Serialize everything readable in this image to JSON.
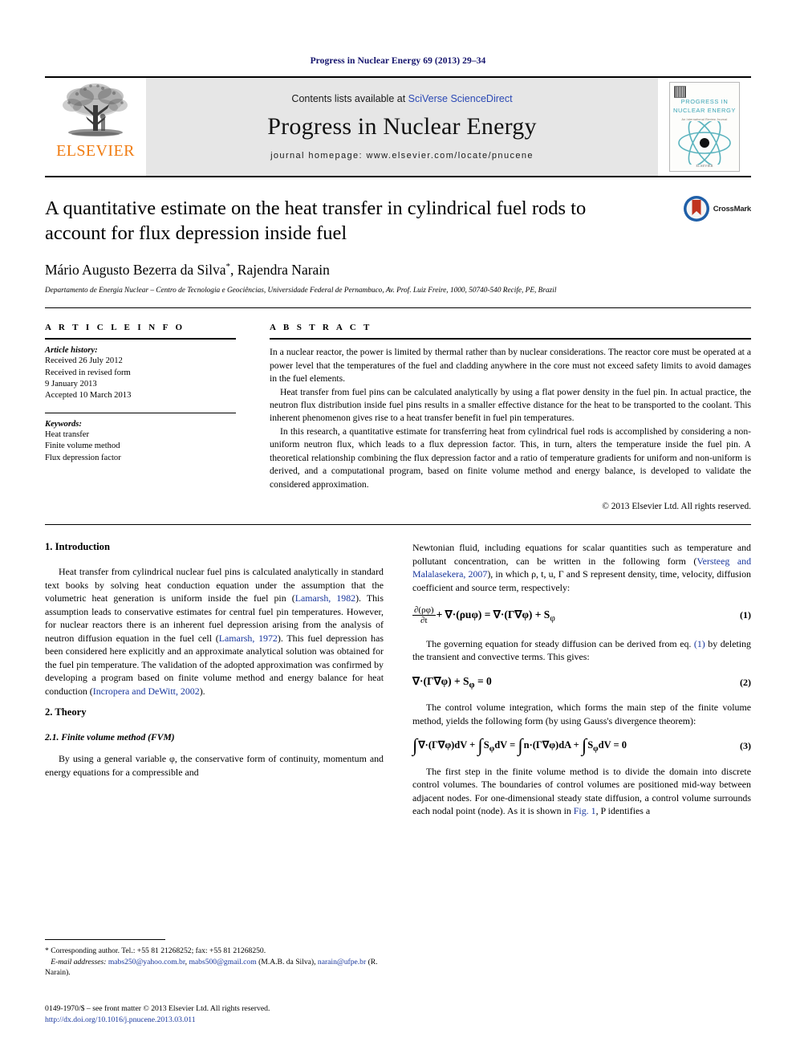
{
  "running_head": "Progress in Nuclear Energy 69 (2013) 29–34",
  "masthead": {
    "publisher_name": "ELSEVIER",
    "publisher_logo_icon": "elsevier-tree-icon",
    "contents_prefix": "Contents lists available at ",
    "contents_link": "SciVerse ScienceDirect",
    "journal_title": "Progress in Nuclear Energy",
    "homepage_line": "journal homepage: www.elsevier.com/locate/pnucene",
    "cover": {
      "title_line1": "PROGRESS IN",
      "title_line2": "NUCLEAR ENERGY",
      "subtitle": "An International Review Journal",
      "atom_icon": "atom-icon",
      "barcode_icon": "barcode-icon",
      "footer": "ELSEVIER\nwww.elsevier.com"
    }
  },
  "article": {
    "title": "A quantitative estimate on the heat transfer in cylindrical fuel rods to account for flux depression inside fuel",
    "crossmark_label": "CrossMark",
    "crossmark_icon": "crossmark-badge-icon",
    "authors": "Mário Augusto Bezerra da Silva",
    "author_star": "*",
    "authors_tail": ", Rajendra Narain",
    "affiliation": "Departamento de Energia Nuclear – Centro de Tecnologia e Geociências, Universidade Federal de Pernambuco, Av. Prof. Luiz Freire, 1000, 50740-540 Recife, PE, Brazil"
  },
  "article_info": {
    "heading": "A R T I C L E   I N F O",
    "history_label": "Article history:",
    "history": [
      "Received 26 July 2012",
      "Received in revised form",
      "9 January 2013",
      "Accepted 10 March 2013"
    ],
    "keywords_label": "Keywords:",
    "keywords": [
      "Heat transfer",
      "Finite volume method",
      "Flux depression factor"
    ]
  },
  "abstract": {
    "heading": "A B S T R A C T",
    "paragraphs": [
      "In a nuclear reactor, the power is limited by thermal rather than by nuclear considerations. The reactor core must be operated at a power level that the temperatures of the fuel and cladding anywhere in the core must not exceed safety limits to avoid damages in the fuel elements.",
      "Heat transfer from fuel pins can be calculated analytically by using a flat power density in the fuel pin. In actual practice, the neutron flux distribution inside fuel pins results in a smaller effective distance for the heat to be transported to the coolant. This inherent phenomenon gives rise to a heat transfer benefit in fuel pin temperatures.",
      "In this research, a quantitative estimate for transferring heat from cylindrical fuel rods is accomplished by considering a non-uniform neutron flux, which leads to a flux depression factor. This, in turn, alters the temperature inside the fuel pin. A theoretical relationship combining the flux depression factor and a ratio of temperature gradients for uniform and non-uniform is derived, and a computational program, based on finite volume method and energy balance, is developed to validate the considered approximation."
    ],
    "copyright": "© 2013 Elsevier Ltd. All rights reserved."
  },
  "body": {
    "left_column": {
      "section1_heading": "1.  Introduction",
      "intro_p1_a": "Heat transfer from cylindrical nuclear fuel pins is calculated analytically in standard text books by solving heat conduction equation under the assumption that the volumetric heat generation is uniform inside the fuel pin (",
      "intro_cite1": "Lamarsh, 1982",
      "intro_p1_b": "). This assumption leads to conservative estimates for central fuel pin temperatures. However, for nuclear reactors there is an inherent fuel depression arising from the analysis of neutron diffusion equation in the fuel cell (",
      "intro_cite2": "Lamarsh, 1972",
      "intro_p1_c": "). This fuel depression has been considered here explicitly and an approximate analytical solution was obtained for the fuel pin temperature. The validation of the adopted approximation was confirmed by developing a program based on finite volume method and energy balance for heat conduction (",
      "intro_cite3": "Incropera and DeWitt, 2002",
      "intro_p1_d": ").",
      "section2_heading": "2.  Theory",
      "subsection21_heading": "2.1.  Finite volume method (FVM)",
      "theory_p1": "By using a general variable φ, the conservative form of continuity, momentum and energy equations for a compressible and"
    },
    "right_column": {
      "cont_p_a": "Newtonian fluid, including equations for scalar quantities such as temperature and pollutant concentration, can be written in the following form (",
      "cont_cite1": "Versteeg and Malalasekera, 2007",
      "cont_p_b": "), in which ρ, t, u, Γ and S represent density, time, velocity, diffusion coefficient and source term, respectively:",
      "eq1_num": "(1)",
      "eq1_frac_num": "∂(ρφ)",
      "eq1_frac_den": "∂t",
      "eq1_rest": "+ ∇·(ρuφ)  =  ∇·(Γ∇φ) + S",
      "eq1_sub": "φ",
      "p_after_eq1_a": "The governing equation for steady diffusion can be derived from eq. ",
      "p_after_eq1_cite": "(1)",
      "p_after_eq1_b": " by deleting the transient and convective terms. This gives:",
      "eq2_num": "(2)",
      "eq2_body": "∇·(Γ∇φ) + S",
      "eq2_sub": "φ",
      "eq2_tail": "  =  0",
      "p_after_eq2": "The control volume integration, which forms the main step of the finite volume method, yields the following form (by using Gauss's divergence theorem):",
      "eq3_num": "(3)",
      "eq3_part1": "∇·(Γ∇φ)dV +",
      "eq3_part2": "S",
      "eq3_part2_sub": "φ",
      "eq3_part2_tail": "dV  =",
      "eq3_part3": "n·(Γ∇φ)dA +",
      "eq3_part4": "S",
      "eq3_part4_sub": "φ",
      "eq3_part4_tail": "dV = 0",
      "last_p_a": "The first step in the finite volume method is to divide the domain into discrete control volumes. The boundaries of control volumes are positioned mid-way between adjacent nodes. For one-dimensional steady state diffusion, a control volume surrounds each nodal point (node). As it is shown in ",
      "last_p_cite": "Fig. 1",
      "last_p_b": ", P identifies a"
    }
  },
  "footnote": {
    "corresponding": "* Corresponding author. Tel.: +55 81 21268252; fax: +55 81 21268250.",
    "email_label": "E-mail addresses:",
    "email1": "mabs250@yahoo.com.br",
    "email_sep1": ", ",
    "email2": "mabs500@gmail.com",
    "email_owner1": " (M.A.B. da Silva), ",
    "email3": "narain@ufpe.br",
    "email_owner2": " (R. Narain)."
  },
  "footer": {
    "issn_line": "0149-1970/$ – see front matter © 2013 Elsevier Ltd. All rights reserved.",
    "doi": "http://dx.doi.org/10.1016/j.pnucene.2013.03.011"
  },
  "colors": {
    "link_blue": "#18369c",
    "running_head_blue": "#12116b",
    "elsevier_orange": "#f07c12",
    "cover_teal": "#3aa3b5",
    "masthead_gray": "#e6e6e6"
  }
}
